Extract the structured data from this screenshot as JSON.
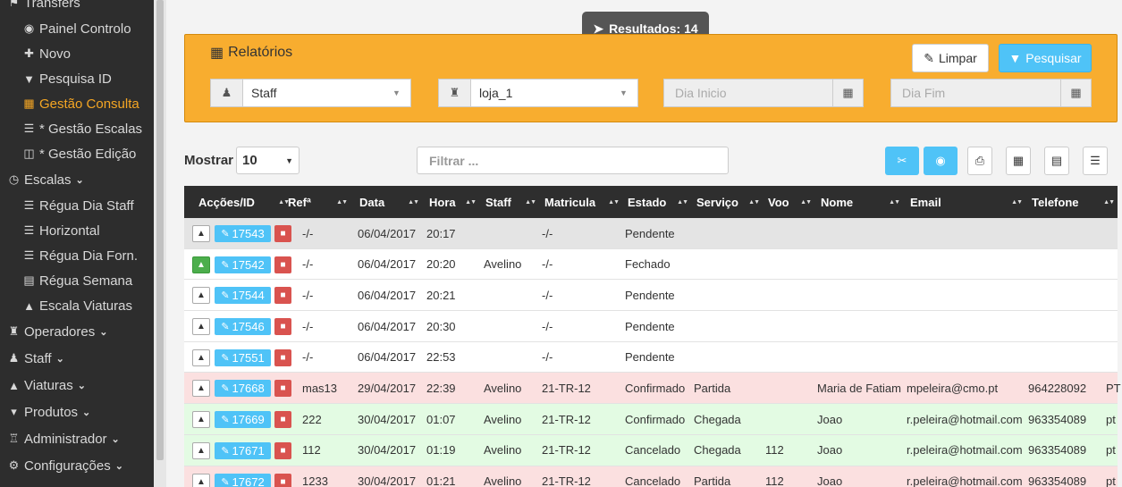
{
  "sidebar": {
    "header": "Transfers",
    "items": [
      {
        "label": "Painel Controlo",
        "icon": "dashboard-icon",
        "type": "sub"
      },
      {
        "label": "Novo",
        "icon": "plus-icon",
        "type": "sub"
      },
      {
        "label": "Pesquisa ID",
        "icon": "filter-icon",
        "type": "sub"
      },
      {
        "label": "Gestão Consulta",
        "icon": "table-icon",
        "type": "sub",
        "active": true
      },
      {
        "label": "* Gestão Escalas",
        "icon": "list-icon",
        "type": "sub"
      },
      {
        "label": "* Gestão Edição",
        "icon": "columns-icon",
        "type": "sub"
      },
      {
        "label": "Escalas",
        "icon": "clock-icon",
        "type": "top"
      },
      {
        "label": "Régua Dia Staff",
        "icon": "list-icon",
        "type": "sub"
      },
      {
        "label": "Horizontal",
        "icon": "list-icon",
        "type": "sub"
      },
      {
        "label": "Régua Dia Forn.",
        "icon": "list-icon",
        "type": "sub"
      },
      {
        "label": "Régua Semana",
        "icon": "calendar-icon",
        "type": "sub"
      },
      {
        "label": "Escala Viaturas",
        "icon": "car-icon",
        "type": "sub"
      },
      {
        "label": "Operadores",
        "icon": "chess-icon",
        "type": "top"
      },
      {
        "label": "Staff",
        "icon": "user-icon",
        "type": "top"
      },
      {
        "label": "Viaturas",
        "icon": "car-icon",
        "type": "top"
      },
      {
        "label": "Produtos",
        "icon": "cart-icon",
        "type": "top"
      },
      {
        "label": "Administrador",
        "icon": "admin-icon",
        "type": "top"
      },
      {
        "label": "Configurações",
        "icon": "gear-icon",
        "type": "top"
      }
    ]
  },
  "results_badge": "Resultados: 14",
  "panel": {
    "title": "Relatórios",
    "clear_label": "Limpar",
    "search_label": "Pesquisar",
    "staff_select": "Staff",
    "store_select": "loja_1",
    "start_placeholder": "Dia Inicio",
    "end_placeholder": "Dia Fim"
  },
  "toolbar": {
    "show_label": "Mostrar",
    "show_value": "10",
    "filter_placeholder": "Filtrar ..."
  },
  "table": {
    "headers": [
      "Acções/ID",
      "Refª",
      "Data",
      "Hora",
      "Staff",
      "Matricula",
      "Estado",
      "Serviço",
      "Voo",
      "Nome",
      "Email",
      "Telefone"
    ],
    "rows": [
      {
        "style": "gray",
        "car_on": false,
        "id": "17543",
        "ref": "-/-",
        "data": "06/04/2017",
        "hora": "20:17",
        "staff": "",
        "matricula": "-/-",
        "estado": "Pendente",
        "servico": "",
        "voo": "",
        "nome": "",
        "email": "",
        "telefone": "",
        "extra": ""
      },
      {
        "style": "white",
        "car_on": true,
        "id": "17542",
        "ref": "-/-",
        "data": "06/04/2017",
        "hora": "20:20",
        "staff": "Avelino",
        "matricula": "-/-",
        "estado": "Fechado",
        "servico": "",
        "voo": "",
        "nome": "",
        "email": "",
        "telefone": "",
        "extra": ""
      },
      {
        "style": "white",
        "car_on": false,
        "id": "17544",
        "ref": "-/-",
        "data": "06/04/2017",
        "hora": "20:21",
        "staff": "",
        "matricula": "-/-",
        "estado": "Pendente",
        "servico": "",
        "voo": "",
        "nome": "",
        "email": "",
        "telefone": "",
        "extra": ""
      },
      {
        "style": "white",
        "car_on": false,
        "id": "17546",
        "ref": "-/-",
        "data": "06/04/2017",
        "hora": "20:30",
        "staff": "",
        "matricula": "-/-",
        "estado": "Pendente",
        "servico": "",
        "voo": "",
        "nome": "",
        "email": "",
        "telefone": "",
        "extra": ""
      },
      {
        "style": "white",
        "car_on": false,
        "id": "17551",
        "ref": "-/-",
        "data": "06/04/2017",
        "hora": "22:53",
        "staff": "",
        "matricula": "-/-",
        "estado": "Pendente",
        "servico": "",
        "voo": "",
        "nome": "",
        "email": "",
        "telefone": "",
        "extra": ""
      },
      {
        "style": "red",
        "car_on": false,
        "id": "17668",
        "ref": "mas13",
        "data": "29/04/2017",
        "hora": "22:39",
        "staff": "Avelino",
        "matricula": "21-TR-12",
        "estado": "Confirmado",
        "servico": "Partida",
        "voo": "",
        "nome": "Maria de Fatiam",
        "email": "mpeleira@cmo.pt",
        "telefone": "964228092",
        "extra": "PT"
      },
      {
        "style": "green",
        "car_on": false,
        "id": "17669",
        "ref": "222",
        "data": "30/04/2017",
        "hora": "01:07",
        "staff": "Avelino",
        "matricula": "21-TR-12",
        "estado": "Confirmado",
        "servico": "Chegada",
        "voo": "",
        "nome": "Joao",
        "email": "r.peleira@hotmail.com",
        "telefone": "963354089",
        "extra": "pt"
      },
      {
        "style": "green",
        "car_on": false,
        "id": "17671",
        "ref": "112",
        "data": "30/04/2017",
        "hora": "01:19",
        "staff": "Avelino",
        "matricula": "21-TR-12",
        "estado": "Cancelado",
        "servico": "Chegada",
        "voo": "112",
        "nome": "Joao",
        "email": "r.peleira@hotmail.com",
        "telefone": "963354089",
        "extra": "pt"
      },
      {
        "style": "red",
        "car_on": false,
        "id": "17672",
        "ref": "1233",
        "data": "30/04/2017",
        "hora": "01:21",
        "staff": "Avelino",
        "matricula": "21-TR-12",
        "estado": "Cancelado",
        "servico": "Partida",
        "voo": "112",
        "nome": "Joao",
        "email": "r.peleira@hotmail.com",
        "telefone": "963354089",
        "extra": "pt"
      }
    ]
  }
}
